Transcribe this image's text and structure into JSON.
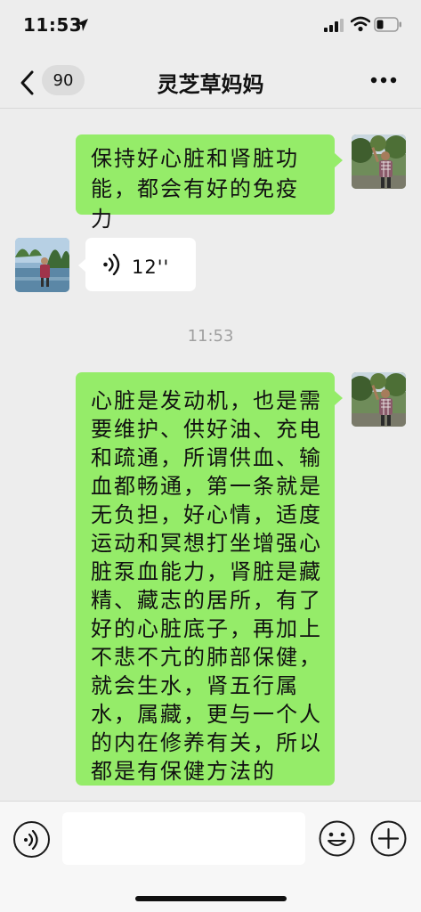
{
  "status_bar": {
    "time": "11:53"
  },
  "nav": {
    "unread_count": "90",
    "title": "灵芝草妈妈"
  },
  "messages": [
    {
      "side": "right",
      "type": "text",
      "text": "保持好心脏和肾脏功\n能，都会有好的免疫力"
    },
    {
      "side": "left",
      "type": "voice",
      "duration": "12''"
    },
    {
      "type": "timestamp",
      "text": "11:53"
    },
    {
      "side": "right",
      "type": "text",
      "text": "心脏是发动机，也是需\n要维护、供好油、充电\n和疏通，所谓供血、输\n血都畅通，第一条就是\n无负担，好心情，适度\n运动和冥想打坐增强心\n脏泵血能力，肾脏是藏\n精、藏志的居所，有了\n好的心脏底子，再加上\n不悲不亢的肺部保健，\n就会生水，肾五行属\n水，属藏，更与一个人\n的内在修养有关，所以\n都是有保健方法的"
    }
  ],
  "input_bar": {
    "placeholder": ""
  },
  "colors": {
    "sent_bubble": "#95ec69",
    "received_bubble": "#ffffff",
    "background": "#ededed"
  },
  "icons": [
    "location-arrow-icon",
    "signal-icon",
    "wifi-icon",
    "battery-icon",
    "back-chevron-icon",
    "more-dots-icon",
    "voice-wave-icon",
    "voice-mode-icon",
    "emoji-icon",
    "plus-icon"
  ]
}
